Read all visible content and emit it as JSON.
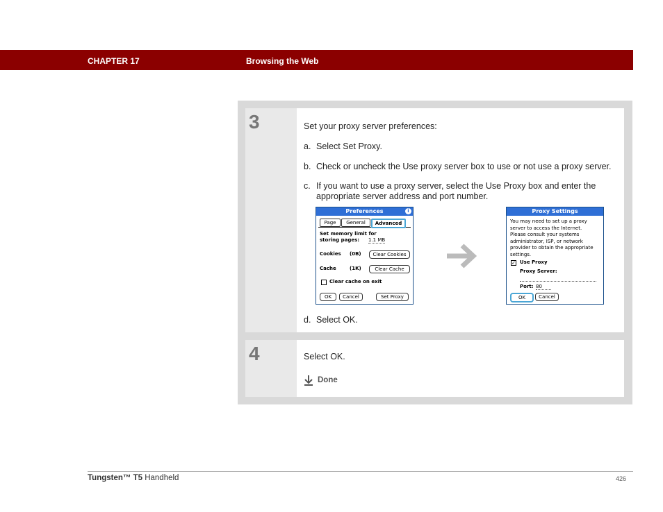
{
  "header": {
    "chapter": "CHAPTER 17",
    "title": "Browsing the Web"
  },
  "step3": {
    "number": "3",
    "intro": "Set your proxy server preferences:",
    "items": [
      {
        "marker": "a.",
        "text": "Select Set Proxy."
      },
      {
        "marker": "b.",
        "text": "Check or uncheck the Use proxy server box to use or not use a proxy server."
      },
      {
        "marker": "c.",
        "text": "If you want to use a proxy server, select the Use Proxy box and enter the appropriate server address and port number."
      },
      {
        "marker": "d.",
        "text": "Select OK."
      }
    ]
  },
  "screen1": {
    "title": "Preferences",
    "tabs": [
      "Page",
      "General",
      "Advanced"
    ],
    "memory_label": "Set memory limit for storing pages:",
    "memory_value": "1.1 MB",
    "cookies_label": "Cookies",
    "cookies_value": "(0B)",
    "clear_cookies": "Clear Cookies",
    "cache_label": "Cache",
    "cache_value": "(1K)",
    "clear_cache": "Clear Cache",
    "clear_on_exit": "Clear cache on exit",
    "ok": "OK",
    "cancel": "Cancel",
    "set_proxy": "Set Proxy"
  },
  "screen2": {
    "title": "Proxy Settings",
    "message": "You may need to set up a proxy server to access the Internet. Please consult your systems administrator, ISP, or network provider to obtain the appropriate settings.",
    "use_proxy": "Use Proxy",
    "proxy_server_label": "Proxy Server:",
    "port_label": "Port:",
    "port_value": "80",
    "ok": "OK",
    "cancel": "Cancel"
  },
  "step4": {
    "number": "4",
    "text": "Select OK.",
    "done": "Done"
  },
  "footer": {
    "product_bold": "Tungsten™ T5",
    "product_rest": " Handheld",
    "page": "426"
  },
  "colors": {
    "header": "#8b0000",
    "palm_title": "#2f6fd6"
  },
  "icons": [
    "arrow-right-icon",
    "done-down-arrow-icon",
    "info-icon",
    "checkbox-icon"
  ]
}
